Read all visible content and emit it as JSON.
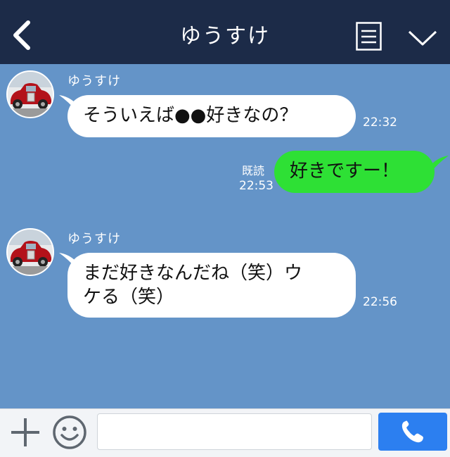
{
  "header": {
    "title": "ゆうすけ",
    "back_icon": "chevron-left-icon",
    "menu_icon": "notes-icon",
    "collapse_icon": "chevron-down-icon"
  },
  "messages": [
    {
      "sender": "ゆうすけ",
      "text": "そういえば●●好きなの？",
      "time": "22:32",
      "side": "left"
    },
    {
      "text": "好きですー！",
      "read": "既読",
      "time": "22:53",
      "side": "right"
    },
    {
      "sender": "ゆうすけ",
      "text_line1": "まだ好きなんだね（笑）ウ",
      "text_line2": "ケる（笑）",
      "time": "22:56",
      "side": "left"
    }
  ],
  "footer": {
    "plus_icon": "plus-icon",
    "emoji_icon": "smile-icon",
    "input_value": "",
    "call_icon": "phone-icon"
  },
  "colors": {
    "header_bg": "#1c2b48",
    "chat_bg": "#6494c8",
    "incoming_bubble": "#ffffff",
    "outgoing_bubble": "#2ee035",
    "call_button": "#2c7ff0"
  }
}
